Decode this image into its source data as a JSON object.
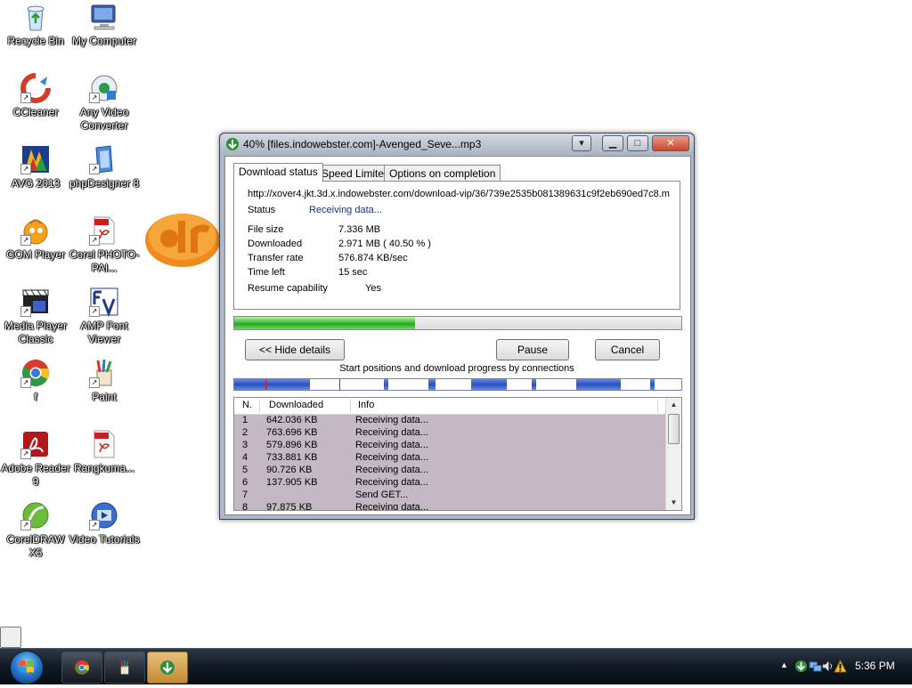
{
  "desktop": {
    "icons": [
      {
        "label": "Recycle Bin",
        "icon": "recycle-bin-icon"
      },
      {
        "label": "My Computer",
        "icon": "my-computer-icon"
      },
      {
        "label": "CCleaner",
        "icon": "ccleaner-icon"
      },
      {
        "label": "Any Video Converter",
        "icon": "any-video-converter-icon"
      },
      {
        "label": "AVG 2013",
        "icon": "avg-icon"
      },
      {
        "label": "phpDesigner 8",
        "icon": "phpdesigner-icon"
      },
      {
        "label": "GOM Player",
        "icon": "gom-player-icon"
      },
      {
        "label": "Corel PHOTO-PAI...",
        "icon": "pdf-file-icon"
      },
      {
        "label": "Media Player Classic",
        "icon": "media-player-classic-icon"
      },
      {
        "label": "AMP Font Viewer",
        "icon": "amp-font-viewer-icon"
      },
      {
        "label": "f",
        "icon": "chrome-icon"
      },
      {
        "label": "Paint",
        "icon": "paint-icon"
      },
      {
        "label": "Adobe Reader 9",
        "icon": "adobe-reader-icon"
      },
      {
        "label": "Rangkuma...",
        "icon": "pdf-file-icon"
      },
      {
        "label": "CorelDRAW X5",
        "icon": "coreldraw-icon"
      },
      {
        "label": "Video Tutorials",
        "icon": "video-tutorials-icon"
      }
    ]
  },
  "window": {
    "title": "40% [files.indowebster.com]-Avenged_Seve...mp3",
    "tabs": [
      "Download status",
      "Speed Limiter",
      "Options on completion"
    ],
    "url": "http://xover4.jkt.3d.x.indowebster.com/download-vip/36/739e2535b081389631c9f2eb690ed7c8.m",
    "status_label": "Status",
    "status_value": "Receiving data...",
    "details": [
      {
        "label": "File size",
        "value": "7.336  MB"
      },
      {
        "label": "Downloaded",
        "value": "2.971  MB  ( 40.50 % )"
      },
      {
        "label": "Transfer rate",
        "value": "576.874  KB/sec"
      },
      {
        "label": "Time left",
        "value": "15 sec"
      }
    ],
    "resume_label": "Resume capability",
    "resume_value": "Yes",
    "progress_percent": 40.5,
    "buttons": {
      "hide_details": "<< Hide details",
      "pause": "Pause",
      "cancel": "Cancel"
    },
    "connections_label": "Start positions and download progress by connections",
    "connection_segments": [
      {
        "start": 0.0,
        "end": 0.17
      },
      {
        "start": 0.335,
        "end": 0.345
      },
      {
        "start": 0.435,
        "end": 0.45
      },
      {
        "start": 0.53,
        "end": 0.61
      },
      {
        "start": 0.665,
        "end": 0.675
      },
      {
        "start": 0.765,
        "end": 0.865
      },
      {
        "start": 0.93,
        "end": 0.94
      }
    ],
    "connection_marks": [
      0.07,
      0.235
    ],
    "table": {
      "headers": [
        "N.",
        "Downloaded",
        "Info"
      ],
      "rows": [
        {
          "n": "1",
          "downloaded": "642.036  KB",
          "info": "Receiving data..."
        },
        {
          "n": "2",
          "downloaded": "763.696  KB",
          "info": "Receiving data..."
        },
        {
          "n": "3",
          "downloaded": "579.896  KB",
          "info": "Receiving data..."
        },
        {
          "n": "4",
          "downloaded": "733.881  KB",
          "info": "Receiving data..."
        },
        {
          "n": "5",
          "downloaded": "90.726  KB",
          "info": "Receiving data..."
        },
        {
          "n": "6",
          "downloaded": "137.905  KB",
          "info": "Receiving data..."
        },
        {
          "n": "7",
          "downloaded": "",
          "info": "Send GET..."
        },
        {
          "n": "8",
          "downloaded": "97.875  KB",
          "info": "Receiving data..."
        }
      ]
    }
  },
  "taskbar": {
    "clock": "5:36 PM"
  }
}
